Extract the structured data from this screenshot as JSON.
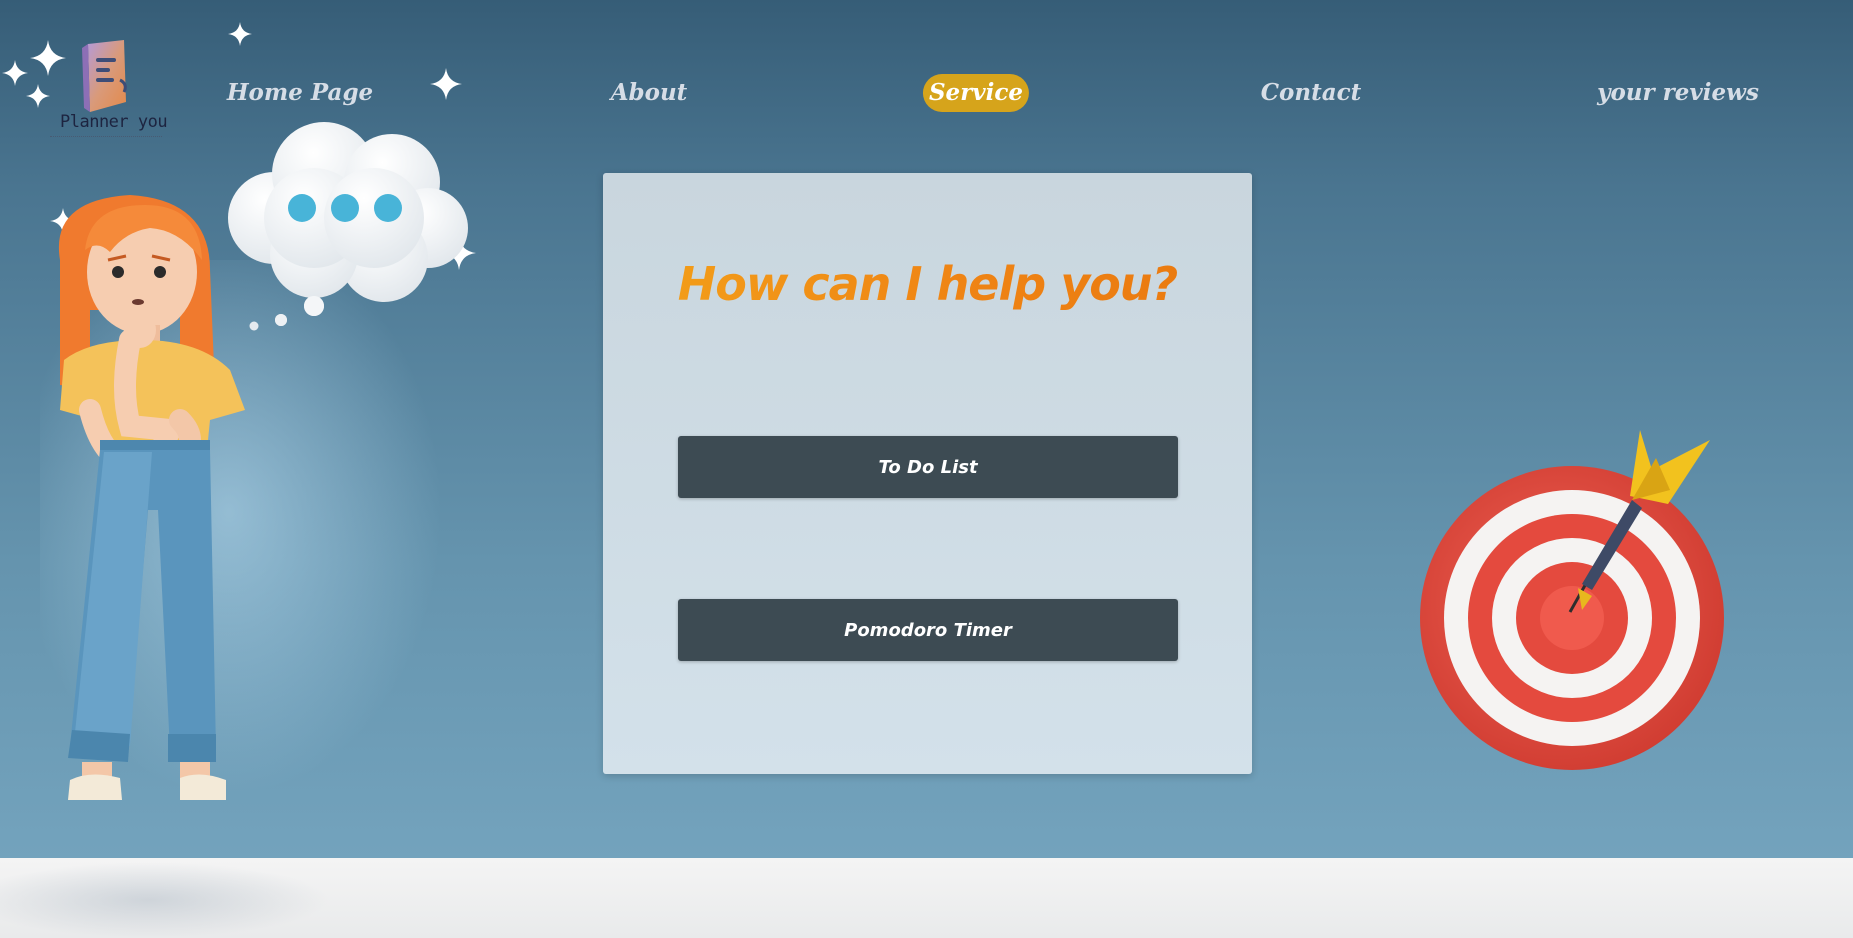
{
  "logo": {
    "name": "Planner you"
  },
  "nav": {
    "items": [
      {
        "label": "Home Page",
        "active": false
      },
      {
        "label": "About",
        "active": false
      },
      {
        "label": "Service",
        "active": true
      },
      {
        "label": "Contact",
        "active": false
      },
      {
        "label": "your reviews",
        "active": false
      }
    ]
  },
  "panel": {
    "title": "How can I help you?",
    "buttons": [
      {
        "label": "To Do List"
      },
      {
        "label": "Pomodoro Timer"
      }
    ]
  },
  "colors": {
    "accent": "#d6a41b",
    "title_orange": "#f08a12",
    "button_bg": "#3d4b53"
  },
  "icons": [
    "sparkle-icon",
    "thought-bubble-icon",
    "target-dart-icon",
    "thinking-girl-illustration",
    "planner-book-icon"
  ]
}
